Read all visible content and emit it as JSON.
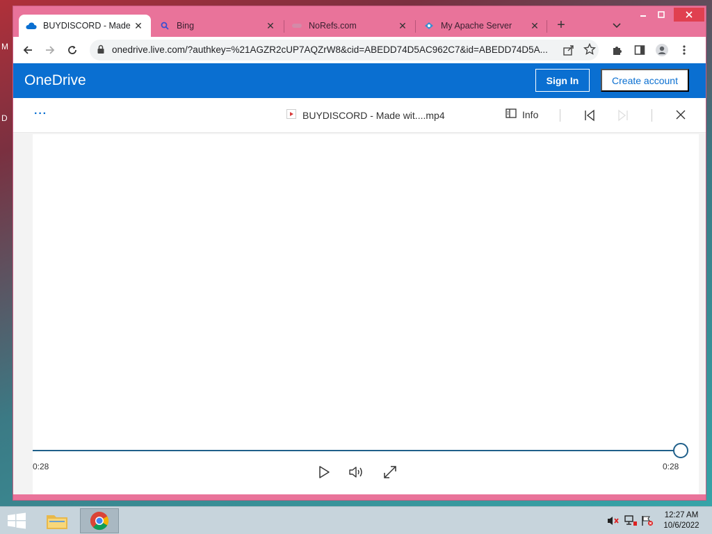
{
  "desktop": {
    "icon_letters": [
      "M",
      "D"
    ]
  },
  "browser": {
    "tabs": [
      {
        "title": "BUYDISCORD - Made w",
        "favicon": "onedrive-cloud-icon",
        "active": true
      },
      {
        "title": "Bing",
        "favicon": "bing-search-icon",
        "active": false
      },
      {
        "title": "NoRefs.com",
        "favicon": "norefs-icon",
        "active": false
      },
      {
        "title": "My Apache Server",
        "favicon": "apache-server-icon",
        "active": false
      }
    ],
    "address": "onedrive.live.com/?authkey=%21AGZR2cUP7AQZrW8&cid=ABEDD74D5AC962C7&id=ABEDD74D5A...",
    "accent_color": "#e9739a"
  },
  "onedrive": {
    "logo": "OneDrive",
    "sign_in": "Sign In",
    "create_account": "Create account",
    "brand_color": "#0a6fd1"
  },
  "viewer": {
    "more": "···",
    "file_name": "BUYDISCORD - Made wit....mp4",
    "info": "Info",
    "time_current": "0:28",
    "time_total": "0:28",
    "progress_percent": 100
  },
  "taskbar": {
    "time": "12:27 AM",
    "date": "10/6/2022"
  }
}
